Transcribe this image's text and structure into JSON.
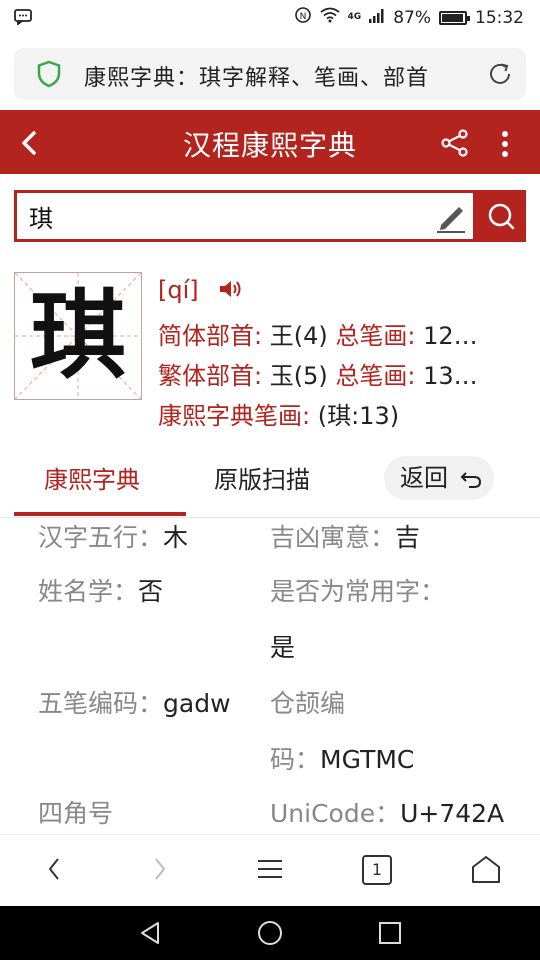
{
  "status_bar": {
    "network_label": "4G",
    "battery": "87%",
    "time": "15:32"
  },
  "browser": {
    "url_title": "康熙字典：琪字解释、笔画、部首"
  },
  "header": {
    "title": "汉程康熙字典"
  },
  "search": {
    "value": "琪"
  },
  "character": {
    "glyph": "琪",
    "pinyin": "[qí]",
    "simplified_radical_label": "简体部首:",
    "simplified_radical_value": "王(4)",
    "simplified_strokes_label": "总笔画:",
    "simplified_strokes_value": "12…",
    "traditional_radical_label": "繁体部首:",
    "traditional_radical_value": "玉(5)",
    "traditional_strokes_label": "总笔画:",
    "traditional_strokes_value": "13…",
    "kangxi_strokes_label": "康熙字典笔画:",
    "kangxi_strokes_value": "(琪:13)"
  },
  "tabs": {
    "kangxi": "康熙字典",
    "scan": "原版扫描",
    "back": "返回"
  },
  "details": {
    "five_elements_label": "汉字五行：",
    "five_elements_value": "木",
    "fortune_label": "吉凶寓意：",
    "fortune_value": "吉",
    "name_study_label": "姓名学：",
    "name_study_value": "否",
    "common_label": "是否为常用字：",
    "common_value": "是",
    "wubi_label": "五笔编码：",
    "wubi_value": "gadw",
    "cangjie_label_1": "仓颉编",
    "cangjie_label_2": "码：",
    "cangjie_value": "MGTMC",
    "four_corner_label": "四角号",
    "unicode_label": "UniCode：",
    "unicode_value": "U+742A"
  },
  "bottom_nav": {
    "tab_count": "1"
  },
  "colors": {
    "brand_red": "#b3241f",
    "muted_text": "#888888"
  }
}
